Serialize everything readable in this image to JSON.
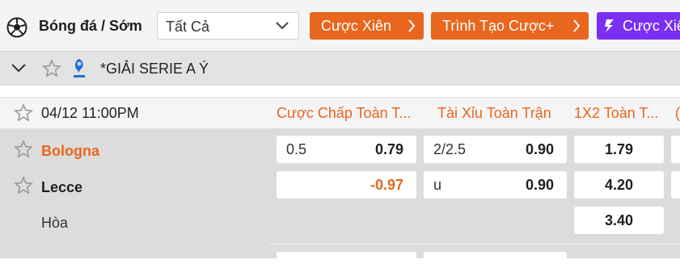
{
  "topbar": {
    "sport_icon": "soccer-ball-icon",
    "title": "Bóng đá / Sớm",
    "filter": {
      "value": "Tất Cả"
    },
    "buttons": [
      {
        "label": "Cược Xiên"
      },
      {
        "label": "Trình Tạo Cược+"
      },
      {
        "label": "Cược Xiê"
      }
    ]
  },
  "league": {
    "name": "*GIẢI SERIE A Ý"
  },
  "match": {
    "datetime": "04/12 11:00PM",
    "columns": [
      "Cược Chấp Toàn T...",
      "Tài Xỉu Toàn Trận",
      "1X2 Toàn T..."
    ],
    "teams": [
      {
        "name": "Bologna",
        "color": "#e8661e",
        "handicap": {
          "line": "0.5",
          "odds": "0.79"
        },
        "overunder": {
          "line": "2/2.5",
          "odds": "0.90"
        },
        "x12": "1.79"
      },
      {
        "name": "Lecce",
        "color": "#1f1f1f",
        "handicap": {
          "line": "",
          "odds": "-0.97"
        },
        "overunder": {
          "line": "u",
          "odds": "0.90"
        },
        "x12": "4.20"
      }
    ],
    "draw": {
      "name": "Hòa",
      "x12": "3.40"
    }
  },
  "colors": {
    "accent": "#e8661e",
    "purple": "#7b2ff2"
  }
}
